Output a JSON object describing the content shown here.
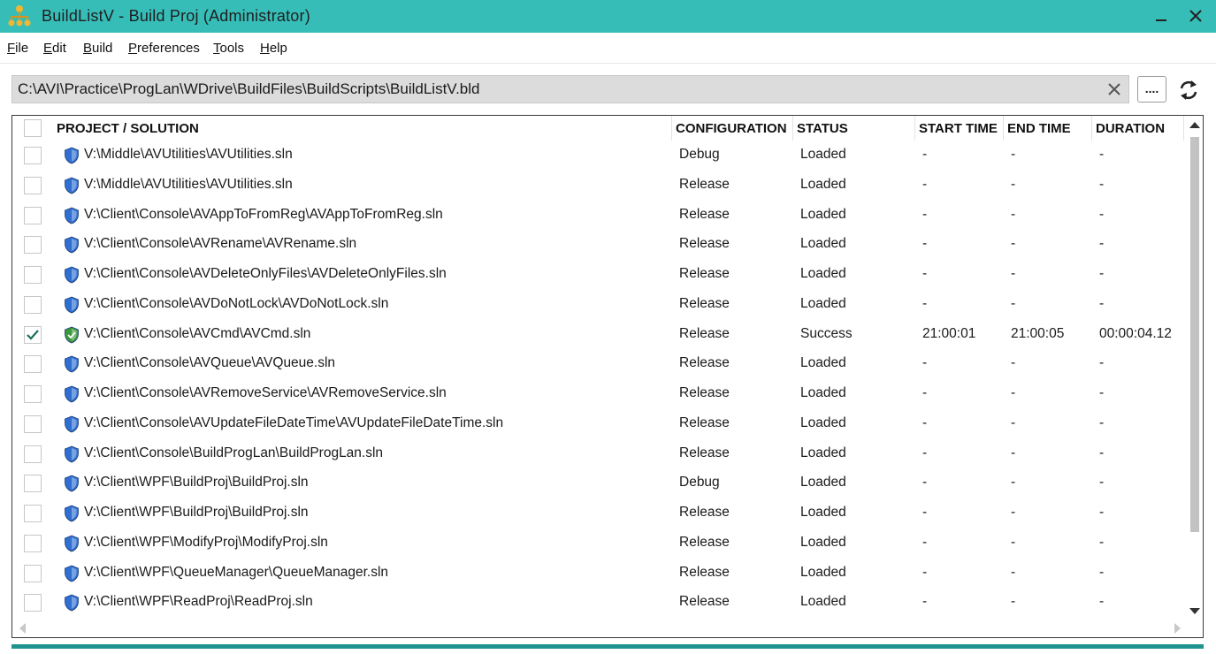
{
  "window": {
    "title": "BuildListV - Build Proj (Administrator)"
  },
  "menu": {
    "items": [
      {
        "key": "F",
        "rest": "ile"
      },
      {
        "key": "E",
        "rest": "dit"
      },
      {
        "key": "B",
        "rest": "uild"
      },
      {
        "key": "P",
        "rest": "references"
      },
      {
        "key": "T",
        "rest": "ools"
      },
      {
        "key": "H",
        "rest": "elp"
      }
    ]
  },
  "path": {
    "value": "C:\\AVI\\Practice\\ProgLan\\WDrive\\BuildFiles\\BuildScripts\\BuildListV.bld",
    "browse_label": "...."
  },
  "grid": {
    "headers": {
      "project": "PROJECT / SOLUTION",
      "configuration": "CONFIGURATION",
      "status": "STATUS",
      "start": "START TIME",
      "end": "END TIME",
      "duration": "DURATION"
    },
    "rows": [
      {
        "checked": false,
        "icon": "shield-blue",
        "project": "V:\\Middle\\AVUtilities\\AVUtilities.sln",
        "configuration": "Debug",
        "status": "Loaded",
        "start": "-",
        "end": "-",
        "duration": "-"
      },
      {
        "checked": false,
        "icon": "shield-blue",
        "project": "V:\\Middle\\AVUtilities\\AVUtilities.sln",
        "configuration": "Release",
        "status": "Loaded",
        "start": "-",
        "end": "-",
        "duration": "-"
      },
      {
        "checked": false,
        "icon": "shield-blue",
        "project": "V:\\Client\\Console\\AVAppToFromReg\\AVAppToFromReg.sln",
        "configuration": "Release",
        "status": "Loaded",
        "start": "-",
        "end": "-",
        "duration": "-"
      },
      {
        "checked": false,
        "icon": "shield-blue",
        "project": "V:\\Client\\Console\\AVRename\\AVRename.sln",
        "configuration": "Release",
        "status": "Loaded",
        "start": "-",
        "end": "-",
        "duration": "-"
      },
      {
        "checked": false,
        "icon": "shield-blue",
        "project": "V:\\Client\\Console\\AVDeleteOnlyFiles\\AVDeleteOnlyFiles.sln",
        "configuration": "Release",
        "status": "Loaded",
        "start": "-",
        "end": "-",
        "duration": "-"
      },
      {
        "checked": false,
        "icon": "shield-blue",
        "project": "V:\\Client\\Console\\AVDoNotLock\\AVDoNotLock.sln",
        "configuration": "Release",
        "status": "Loaded",
        "start": "-",
        "end": "-",
        "duration": "-"
      },
      {
        "checked": true,
        "icon": "shield-green",
        "project": "V:\\Client\\Console\\AVCmd\\AVCmd.sln",
        "configuration": "Release",
        "status": "Success",
        "start": "21:00:01",
        "end": "21:00:05",
        "duration": "00:00:04.12"
      },
      {
        "checked": false,
        "icon": "shield-blue",
        "project": "V:\\Client\\Console\\AVQueue\\AVQueue.sln",
        "configuration": "Release",
        "status": "Loaded",
        "start": "-",
        "end": "-",
        "duration": "-"
      },
      {
        "checked": false,
        "icon": "shield-blue",
        "project": "V:\\Client\\Console\\AVRemoveService\\AVRemoveService.sln",
        "configuration": "Release",
        "status": "Loaded",
        "start": "-",
        "end": "-",
        "duration": "-"
      },
      {
        "checked": false,
        "icon": "shield-blue",
        "project": "V:\\Client\\Console\\AVUpdateFileDateTime\\AVUpdateFileDateTime.sln",
        "configuration": "Release",
        "status": "Loaded",
        "start": "-",
        "end": "-",
        "duration": "-"
      },
      {
        "checked": false,
        "icon": "shield-blue",
        "project": "V:\\Client\\Console\\BuildProgLan\\BuildProgLan.sln",
        "configuration": "Release",
        "status": "Loaded",
        "start": "-",
        "end": "-",
        "duration": "-"
      },
      {
        "checked": false,
        "icon": "shield-blue",
        "project": "V:\\Client\\WPF\\BuildProj\\BuildProj.sln",
        "configuration": "Debug",
        "status": "Loaded",
        "start": "-",
        "end": "-",
        "duration": "-"
      },
      {
        "checked": false,
        "icon": "shield-blue",
        "project": "V:\\Client\\WPF\\BuildProj\\BuildProj.sln",
        "configuration": "Release",
        "status": "Loaded",
        "start": "-",
        "end": "-",
        "duration": "-"
      },
      {
        "checked": false,
        "icon": "shield-blue",
        "project": "V:\\Client\\WPF\\ModifyProj\\ModifyProj.sln",
        "configuration": "Release",
        "status": "Loaded",
        "start": "-",
        "end": "-",
        "duration": "-"
      },
      {
        "checked": false,
        "icon": "shield-blue",
        "project": "V:\\Client\\WPF\\QueueManager\\QueueManager.sln",
        "configuration": "Release",
        "status": "Loaded",
        "start": "-",
        "end": "-",
        "duration": "-"
      },
      {
        "checked": false,
        "icon": "shield-blue",
        "project": "V:\\Client\\WPF\\ReadProj\\ReadProj.sln",
        "configuration": "Release",
        "status": "Loaded",
        "start": "-",
        "end": "-",
        "duration": "-"
      }
    ]
  },
  "colors": {
    "titlebar": "#36bdb8",
    "accent": "#1f948f",
    "shield_blue": "#2f6fd1",
    "shield_green": "#3a9a3a",
    "check": "#1a6e5e"
  }
}
